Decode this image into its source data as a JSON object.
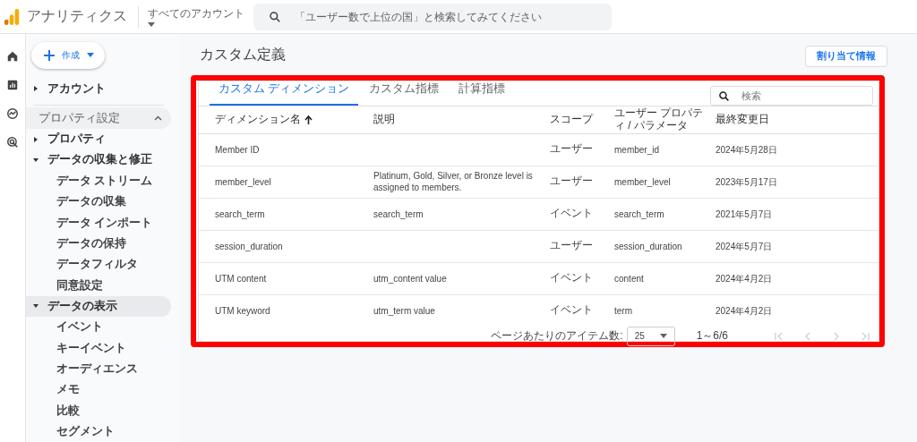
{
  "header": {
    "app_title": "アナリティクス",
    "account_label": "すべてのアカウント",
    "search": {
      "placeholder": "「ユーザー数で上位の国」と検索してみてください"
    }
  },
  "rail": [
    {
      "kind": "home",
      "selected": false
    },
    {
      "kind": "reports",
      "selected": false
    },
    {
      "kind": "explore",
      "selected": false
    },
    {
      "kind": "ads",
      "selected": false
    }
  ],
  "create_button": "作成",
  "sidebar": [
    {
      "kind": "item",
      "label": "アカウント",
      "expanded": false,
      "selected": false
    },
    {
      "kind": "section",
      "label": "プロパティ設定",
      "expanded": true
    },
    {
      "kind": "item",
      "label": "プロパティ",
      "expanded": false,
      "selected": false
    },
    {
      "kind": "item",
      "label": "データの収集と修正",
      "expanded": true,
      "selected": false,
      "children": [
        {
          "label": "データ ストリーム"
        },
        {
          "label": "データの収集"
        },
        {
          "label": "データ インポート"
        },
        {
          "label": "データの保持"
        },
        {
          "label": "データフィルタ"
        },
        {
          "label": "同意設定"
        }
      ]
    },
    {
      "kind": "item",
      "label": "データの表示",
      "expanded": true,
      "selected": true,
      "children": [
        {
          "label": "イベント"
        },
        {
          "label": "キーイベント"
        },
        {
          "label": "オーディエンス"
        },
        {
          "label": "メモ"
        },
        {
          "label": "比較"
        },
        {
          "label": "セグメント"
        }
      ]
    }
  ],
  "page_title": "カスタム定義",
  "assign_button": "割り当て情報",
  "tabs": [
    {
      "label": "カスタム ディメンション",
      "selected": true
    },
    {
      "label": "カスタム指標",
      "selected": false
    },
    {
      "label": "計算指標",
      "selected": false
    }
  ],
  "table_search": {
    "placeholder": "検索"
  },
  "table": {
    "columns": [
      {
        "label": "ディメンション名",
        "sorted": true
      },
      {
        "label": "説明",
        "sorted": false
      },
      {
        "label": "スコープ",
        "sorted": false
      },
      {
        "label": "ユーザー プロパティ / パラメータ",
        "sorted": false
      },
      {
        "label": "最終変更日",
        "sorted": false
      }
    ],
    "rows": [
      [
        "Member ID",
        "",
        "ユーザー",
        "member_id",
        "2024年5月28日"
      ],
      [
        "member_level",
        "Platinum, Gold, Silver, or Bronze level is assigned to members.",
        "ユーザー",
        "member_level",
        "2023年5月17日"
      ],
      [
        "search_term",
        "search_term",
        "イベント",
        "search_term",
        "2021年5月7日"
      ],
      [
        "session_duration",
        "",
        "ユーザー",
        "session_duration",
        "2024年5月7日"
      ],
      [
        "UTM content",
        "utm_content value",
        "イベント",
        "content",
        "2024年4月2日"
      ],
      [
        "UTM keyword",
        "utm_term value",
        "イベント",
        "term",
        "2024年4月2日"
      ]
    ]
  },
  "pagination": {
    "per_page_label": "ページあたりのアイテム数:",
    "per_page": "25",
    "range": "1～6/6"
  }
}
